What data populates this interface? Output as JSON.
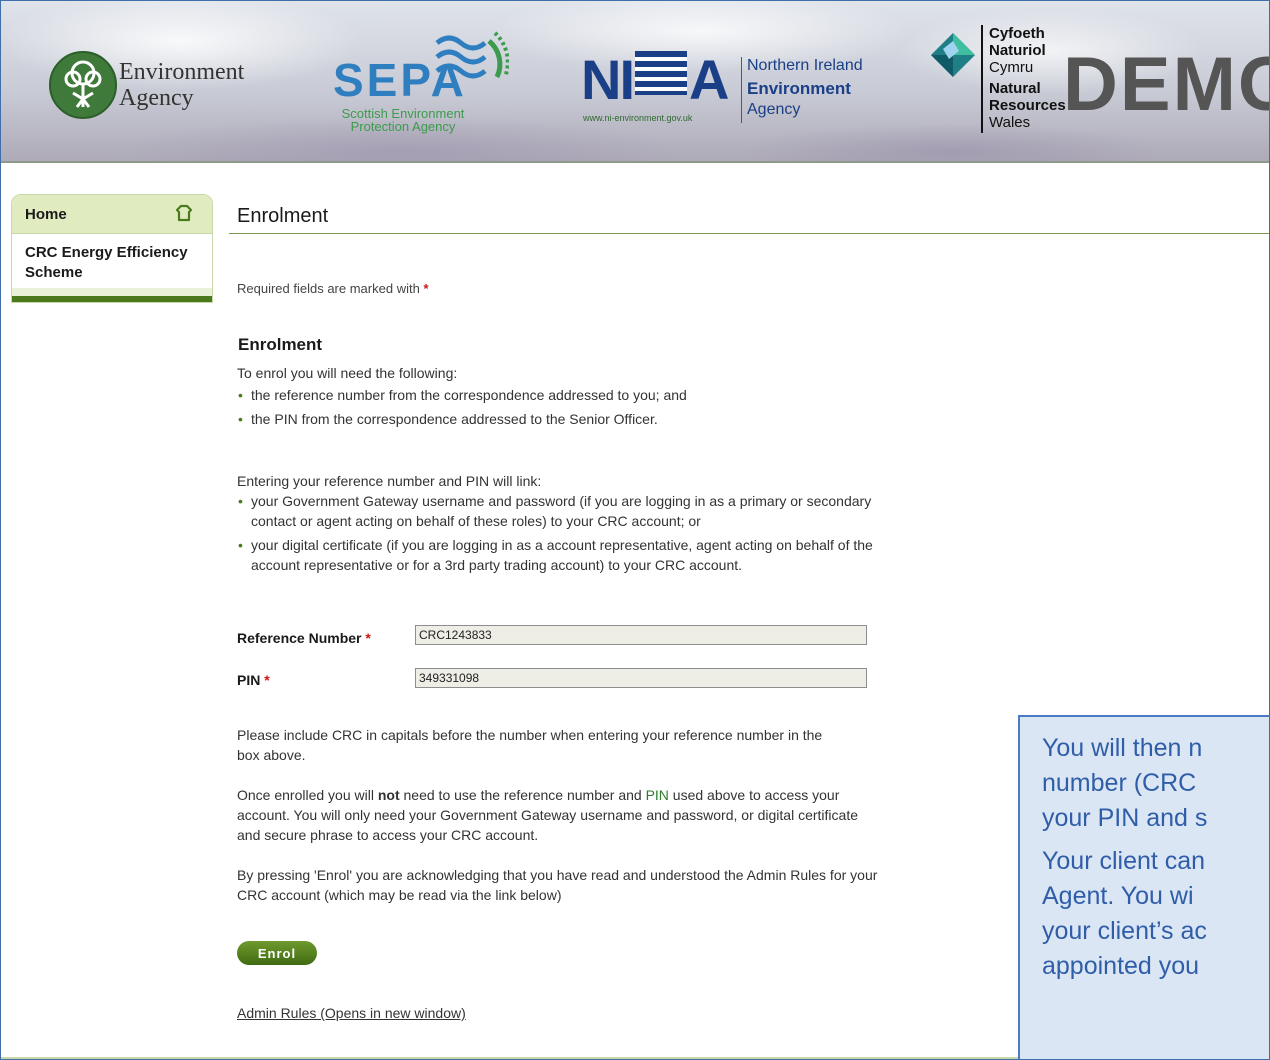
{
  "colors": {
    "accent_green": "#4b7a1e",
    "callout_text": "#2f5da8",
    "required_star": "#d01414"
  },
  "header": {
    "ea": {
      "line1": "Environment",
      "line2": "Agency",
      "icon": "tree-person-icon"
    },
    "sepa": {
      "word": "SEPA",
      "sub1": "Scottish Environment",
      "sub2": "Protection Agency",
      "icon": "sepa-waves-icon"
    },
    "niea": {
      "mark_left": "NI",
      "mark_right": "A",
      "url": "www.ni-environment.gov.uk",
      "line1": "Northern Ireland",
      "line2": "Environment",
      "line3": "Agency"
    },
    "nrw": {
      "lines": [
        "Cyfoeth",
        "Naturiol",
        "Cymru",
        "Natural",
        "Resources",
        "Wales"
      ],
      "icon": "nrw-diamond-icon"
    },
    "demo_label": "DEMO"
  },
  "sidebar": {
    "home_label": "Home",
    "home_icon": "home-icon",
    "items": [
      {
        "label": "CRC Energy Efficiency Scheme"
      }
    ]
  },
  "main": {
    "title": "Enrolment",
    "required_note": "Required fields are marked with",
    "required_star": "*",
    "section_heading": "Enrolment",
    "intro": "To enrol you will need the following:",
    "need_items": [
      "the reference number from the correspondence addressed to you; and",
      "the PIN from the correspondence addressed to the Senior Officer."
    ],
    "link_intro": "Entering your reference number and PIN will link:",
    "link_items": [
      "your Government Gateway username and password (if you are logging in as a primary or secondary contact or agent acting on behalf of these roles) to your CRC account; or",
      "your digital certificate (if you are logging in as a account representative, agent acting on behalf of the account representative or for a 3rd party trading account) to your CRC account."
    ],
    "form": {
      "reference_label": "Reference Number",
      "reference_value": "CRC1243833",
      "pin_label": "PIN",
      "pin_value": "349331098"
    },
    "para_capitals": "Please include CRC in capitals before the number when entering your reference number in the box above.",
    "para_once_a": "Once enrolled you will ",
    "para_once_bold": "not",
    "para_once_b": " need to use the reference number and ",
    "para_once_pin": "PIN",
    "para_once_c": " used above to access your account. You will only need your Government Gateway username and password, or digital certificate and secure phrase to access your CRC account.",
    "para_pressing": "By pressing 'Enrol' you are acknowledging that you have read and understood the Admin Rules for your CRC account (which may be read via the link below)",
    "enrol_button": "Enrol",
    "admin_link": "Admin Rules (Opens in new window)"
  },
  "callout": {
    "p1_lines": [
      "You will then n",
      "number (CRC",
      "your PIN and s"
    ],
    "p2_lines": [
      "Your client can",
      "Agent.  You wi",
      "your client’s ac",
      "appointed you"
    ]
  }
}
